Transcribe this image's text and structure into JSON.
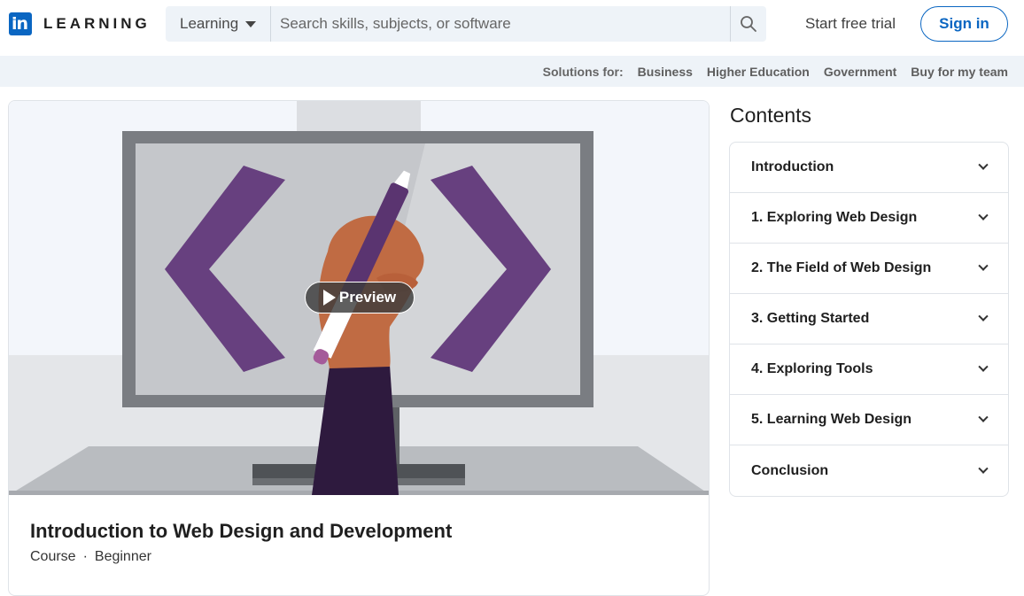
{
  "header": {
    "logo_mark": "in",
    "logo_text": "LEARNING",
    "search_scope": "Learning",
    "search_placeholder": "Search skills, subjects, or software",
    "trial_label": "Start free trial",
    "signin_label": "Sign in"
  },
  "solutions": {
    "label": "Solutions for:",
    "links": [
      "Business",
      "Higher Education",
      "Government",
      "Buy for my team"
    ]
  },
  "course": {
    "preview_label": "Preview",
    "title": "Introduction to Web Design and Development",
    "type": "Course",
    "separator": "·",
    "level": "Beginner"
  },
  "contents": {
    "heading": "Contents",
    "items": [
      "Introduction",
      "1. Exploring Web Design",
      "2. The Field of Web Design",
      "3. Getting Started",
      "4. Exploring Tools",
      "5. Learning Web Design",
      "Conclusion"
    ]
  },
  "colors": {
    "brand": "#0a66c2",
    "purple": "#67407f",
    "bar_bg": "#eef3f8"
  }
}
